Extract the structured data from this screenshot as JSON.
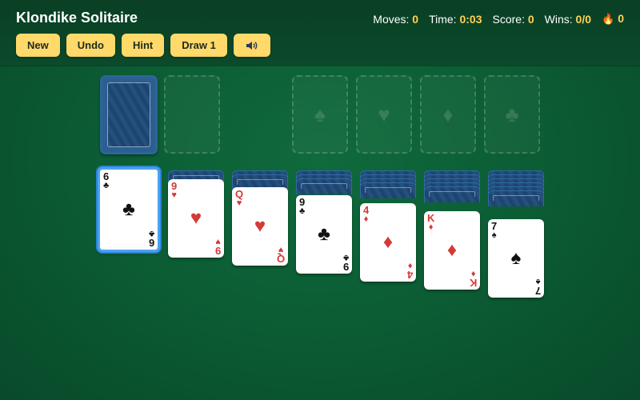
{
  "header": {
    "title": "Klondike Solitaire",
    "moves_label": "Moves:",
    "moves": "0",
    "time_label": "Time:",
    "time": "0:03",
    "score_label": "Score:",
    "score": "0",
    "wins_label": "Wins:",
    "wins": "0/0",
    "streak": "0"
  },
  "toolbar": {
    "new": "New",
    "undo": "Undo",
    "hint": "Hint",
    "draw": "Draw 1",
    "sound_icon": "speaker-icon"
  },
  "foundations": [
    "♠",
    "♥",
    "♦",
    "♣"
  ],
  "tableau": [
    {
      "facedown": 0,
      "rank": "6",
      "suit": "♣",
      "color": "black",
      "selected": true
    },
    {
      "facedown": 1,
      "rank": "9",
      "suit": "♥",
      "color": "red"
    },
    {
      "facedown": 2,
      "rank": "Q",
      "suit": "♥",
      "color": "red"
    },
    {
      "facedown": 3,
      "rank": "9",
      "suit": "♣",
      "color": "black"
    },
    {
      "facedown": 4,
      "rank": "4",
      "suit": "♦",
      "color": "red"
    },
    {
      "facedown": 5,
      "rank": "K",
      "suit": "♦",
      "color": "red"
    },
    {
      "facedown": 6,
      "rank": "7",
      "suit": "♠",
      "color": "black"
    }
  ]
}
